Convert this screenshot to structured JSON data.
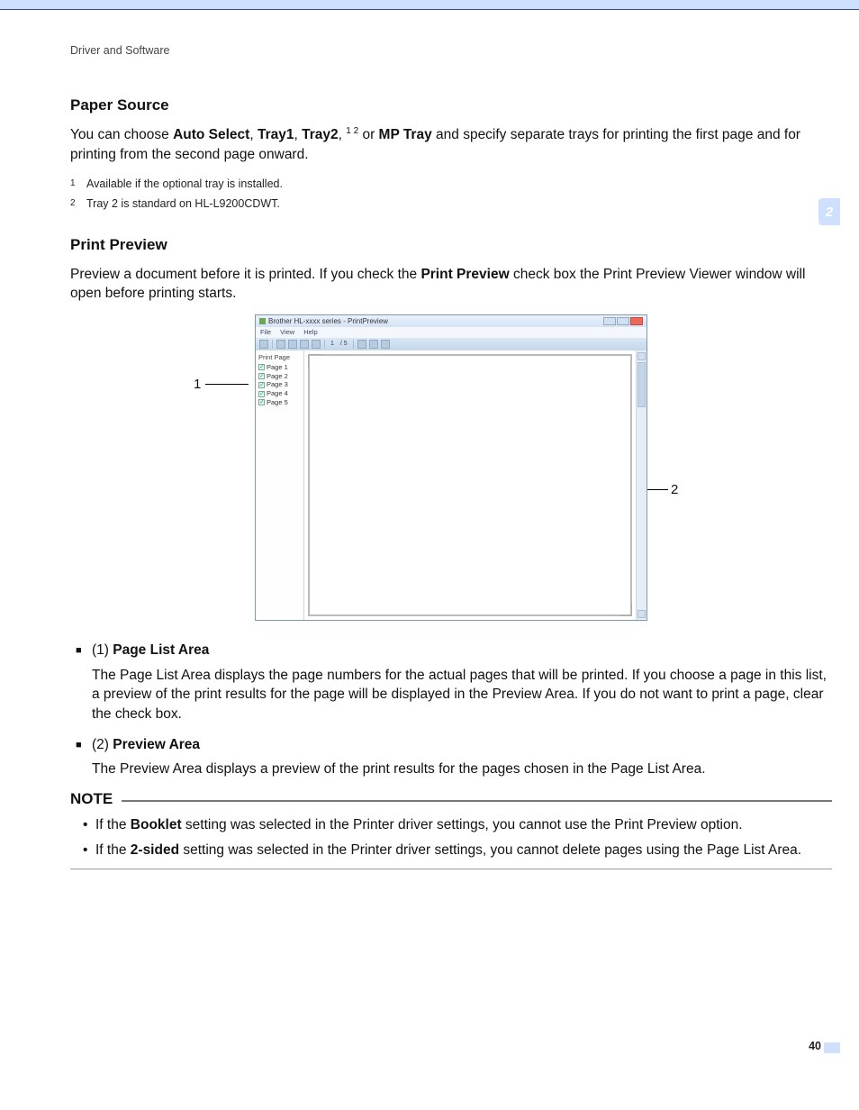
{
  "breadcrumb": "Driver and Software",
  "chapter_tab": "2",
  "page_number": "40",
  "paper_source": {
    "heading": "Paper Source",
    "intro_pre": "You can choose ",
    "opt1": "Auto Select",
    "sep1": ", ",
    "opt2": "Tray1",
    "sep2": ", ",
    "opt3": "Tray2",
    "sep3": ", ",
    "sup12": "1 2",
    "intro_mid": " or ",
    "opt4": "MP Tray",
    "intro_post": " and specify separate trays for printing the first page and for printing from the second page onward.",
    "footnotes": [
      {
        "num": "1",
        "text": "Available if the optional tray is installed."
      },
      {
        "num": "2",
        "text": "Tray 2 is standard on HL-L9200CDWT."
      }
    ]
  },
  "print_preview": {
    "heading": "Print Preview",
    "intro_pre": "Preview a document before it is printed. If you check the ",
    "bold1": "Print Preview",
    "intro_post": " check box the Print Preview Viewer window will open before printing starts."
  },
  "screenshot": {
    "title": "Brother  HL-xxxx series - PrintPreview",
    "menus": [
      "File",
      "View",
      "Help"
    ],
    "page_indicator": "1",
    "page_total": "/ 5",
    "page_list_head": "Print Page",
    "pages": [
      "Page 1",
      "Page 2",
      "Page 3",
      "Page 4",
      "Page 5"
    ]
  },
  "callouts": {
    "one": "1",
    "two": "2"
  },
  "areas": [
    {
      "label_num": "(1) ",
      "label_bold": "Page List Area",
      "desc": "The Page List Area displays the page numbers for the actual pages that will be printed. If you choose a page in this list, a preview of the print results for the page will be displayed in the Preview Area. If you do not want to print a page, clear the check box."
    },
    {
      "label_num": "(2) ",
      "label_bold": "Preview Area",
      "desc": "The Preview Area displays a preview of the print results for the pages chosen in the Page List Area."
    }
  ],
  "note": {
    "label": "NOTE",
    "items": [
      {
        "pre": "If the ",
        "bold": "Booklet",
        "post": " setting was selected in the Printer driver settings, you cannot use the Print Preview option."
      },
      {
        "pre": "If the ",
        "bold": "2-sided",
        "post": " setting was selected in the Printer driver settings, you cannot delete pages using the Page List Area."
      }
    ]
  }
}
